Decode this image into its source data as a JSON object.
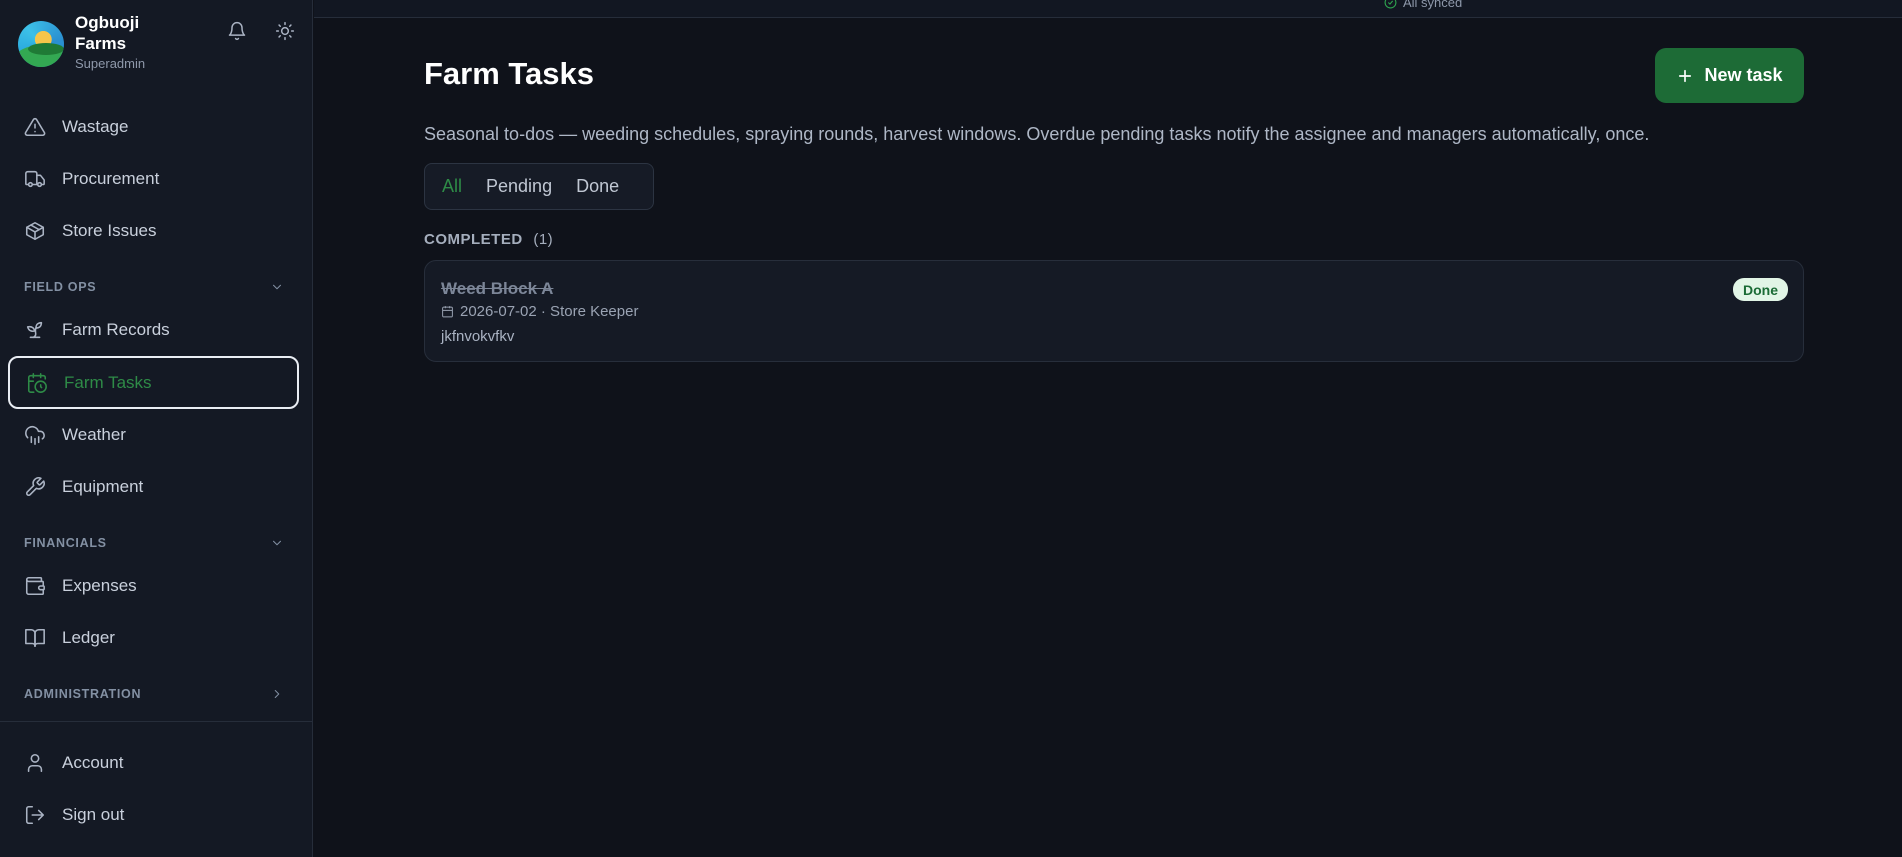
{
  "brand": {
    "name": "Ogbuoji Farms",
    "role": "Superadmin",
    "logo": "farm-logo"
  },
  "header_icons": [
    "bell-icon",
    "sun-icon"
  ],
  "sidebar": {
    "items_top": [
      {
        "label": "Wastage",
        "icon": "warning-icon"
      },
      {
        "label": "Procurement",
        "icon": "truck-icon"
      },
      {
        "label": "Store Issues",
        "icon": "package-icon"
      }
    ],
    "field_ops": {
      "title": "FIELD OPS",
      "items": [
        {
          "label": "Farm Records",
          "icon": "sprout-icon"
        },
        {
          "label": "Farm Tasks",
          "icon": "calendar-clock-icon",
          "active": true
        },
        {
          "label": "Weather",
          "icon": "cloud-rain-icon"
        },
        {
          "label": "Equipment",
          "icon": "wrench-icon"
        }
      ]
    },
    "financials": {
      "title": "FINANCIALS",
      "items": [
        {
          "label": "Expenses",
          "icon": "wallet-icon"
        },
        {
          "label": "Ledger",
          "icon": "book-icon"
        }
      ]
    },
    "administration": {
      "title": "ADMINISTRATION"
    },
    "bottom": [
      {
        "label": "Account",
        "icon": "user-icon"
      },
      {
        "label": "Sign out",
        "icon": "logout-icon"
      }
    ]
  },
  "topbar": {
    "sync_status": "All synced"
  },
  "main": {
    "title": "Farm Tasks",
    "new_task_label": "New task",
    "description": "Seasonal to-dos — weeding schedules, spraying rounds, harvest windows. Overdue pending tasks notify the assignee and managers automatically, once.",
    "filters": [
      "All",
      "Pending",
      "Done"
    ],
    "active_filter": "All",
    "group": {
      "title": "COMPLETED",
      "count": "(1)"
    },
    "tasks": [
      {
        "title": "Weed Block A",
        "date": "2026-07-02",
        "assignee": "Store Keeper",
        "meta": "2026-07-02 · Store Keeper",
        "note": "jkfnvokvfkv",
        "status": "Done"
      }
    ]
  },
  "colors": {
    "accent": "#1d6b36",
    "active": "#2e8b47",
    "badge_bg": "#e1f5e6"
  }
}
